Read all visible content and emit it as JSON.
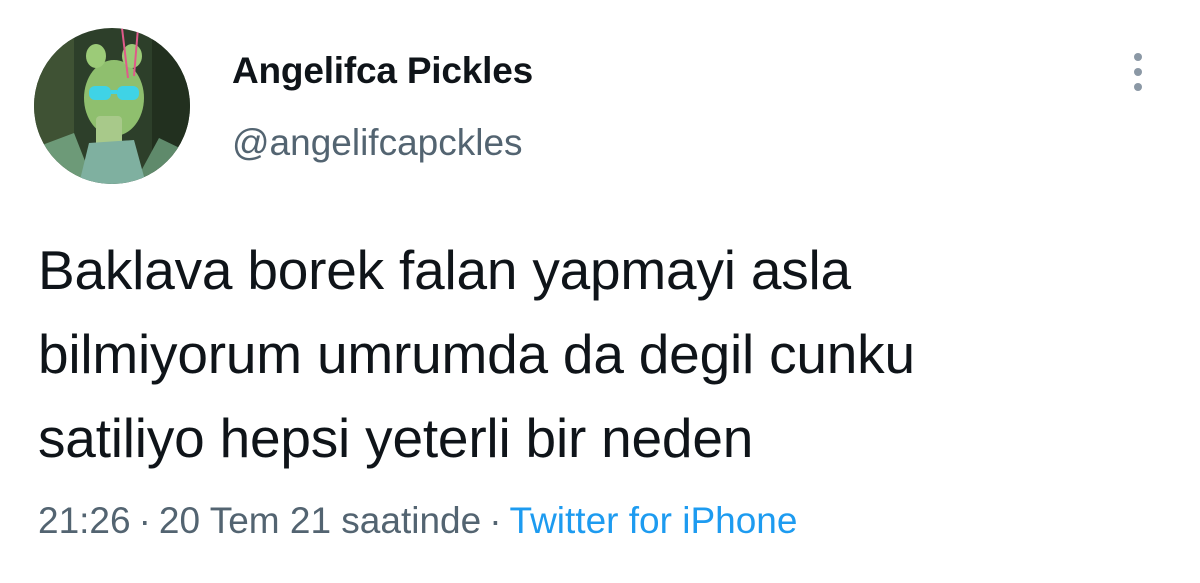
{
  "author": {
    "display_name": "Angelifca Pickles",
    "handle": "@angelifcapckles",
    "avatar_icon": "profile-photo"
  },
  "more_icon": "more-vertical-icon",
  "tweet": {
    "text_lines": [
      "Baklava borek falan yapmayi asla",
      "bilmiyorum umrumda da degil cunku",
      "satiliyo hepsi yeterli bir neden"
    ]
  },
  "meta": {
    "time": "21:26",
    "separator": "·",
    "date": "20 Tem 21 saatinde",
    "source": "Twitter for iPhone"
  },
  "colors": {
    "text": "#0f1419",
    "secondary": "#536471",
    "link": "#1d9bf0",
    "dots": "#8b98a5"
  }
}
